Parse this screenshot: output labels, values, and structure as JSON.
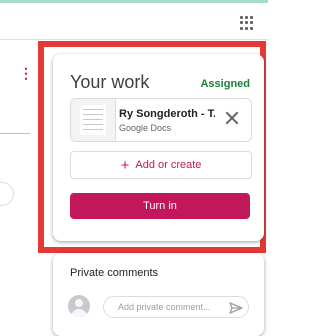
{
  "your_work": {
    "title": "Your work",
    "status": "Assigned",
    "attachment": {
      "name": "Ry Songderoth - T...",
      "type": "Google Docs"
    },
    "add_label": "Add or create",
    "add_icon": "plus-icon",
    "turn_in_label": "Turn in"
  },
  "private_comments": {
    "title": "Private comments",
    "placeholder": "Add private comment...",
    "send_icon": "send-icon"
  },
  "colors": {
    "accent": "#c2185b",
    "status": "#188038",
    "highlight": "#e53935"
  }
}
